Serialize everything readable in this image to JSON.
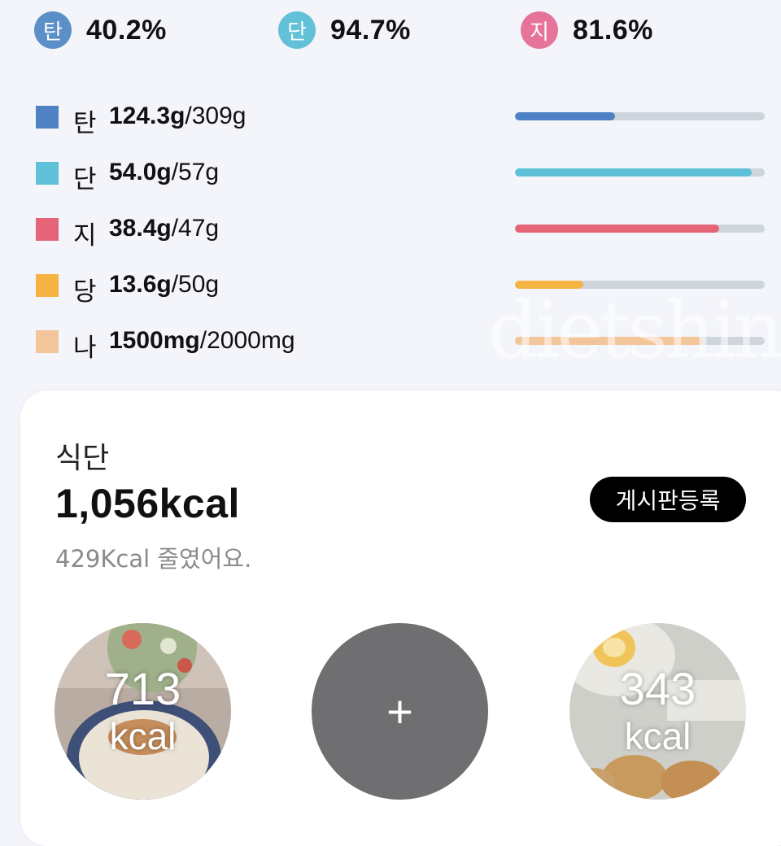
{
  "summary": [
    {
      "label": "탄",
      "value": "40.2%",
      "color": "#5b8fc8"
    },
    {
      "label": "단",
      "value": "94.7%",
      "color": "#62c1d6"
    },
    {
      "label": "지",
      "value": "81.6%",
      "color": "#e5739a"
    }
  ],
  "nutrients": [
    {
      "label": "탄",
      "amount": "124.3g",
      "target": "/309g",
      "color": "#4f82c4",
      "progress": 0.402
    },
    {
      "label": "단",
      "amount": "54.0g",
      "target": "/57g",
      "color": "#5ec1d7",
      "progress": 0.947
    },
    {
      "label": "지",
      "amount": "38.4g",
      "target": "/47g",
      "color": "#e56478",
      "progress": 0.816
    },
    {
      "label": "당",
      "amount": "13.6g",
      "target": "/50g",
      "color": "#f5b342",
      "progress": 0.272
    },
    {
      "label": "나",
      "amount": "1500mg",
      "target": "/2000mg",
      "color": "#f2c59a",
      "progress": 0.75
    }
  ],
  "meal_card": {
    "title": "식단",
    "total_kcal": "1,056kcal",
    "subtitle": "429Kcal 줄였어요.",
    "board_button": "게시판등록",
    "meals": [
      {
        "value": "713",
        "unit": "kcal"
      },
      {
        "value": "+",
        "unit": ""
      },
      {
        "value": "343",
        "unit": "kcal"
      }
    ]
  },
  "watermark": "dietshin"
}
